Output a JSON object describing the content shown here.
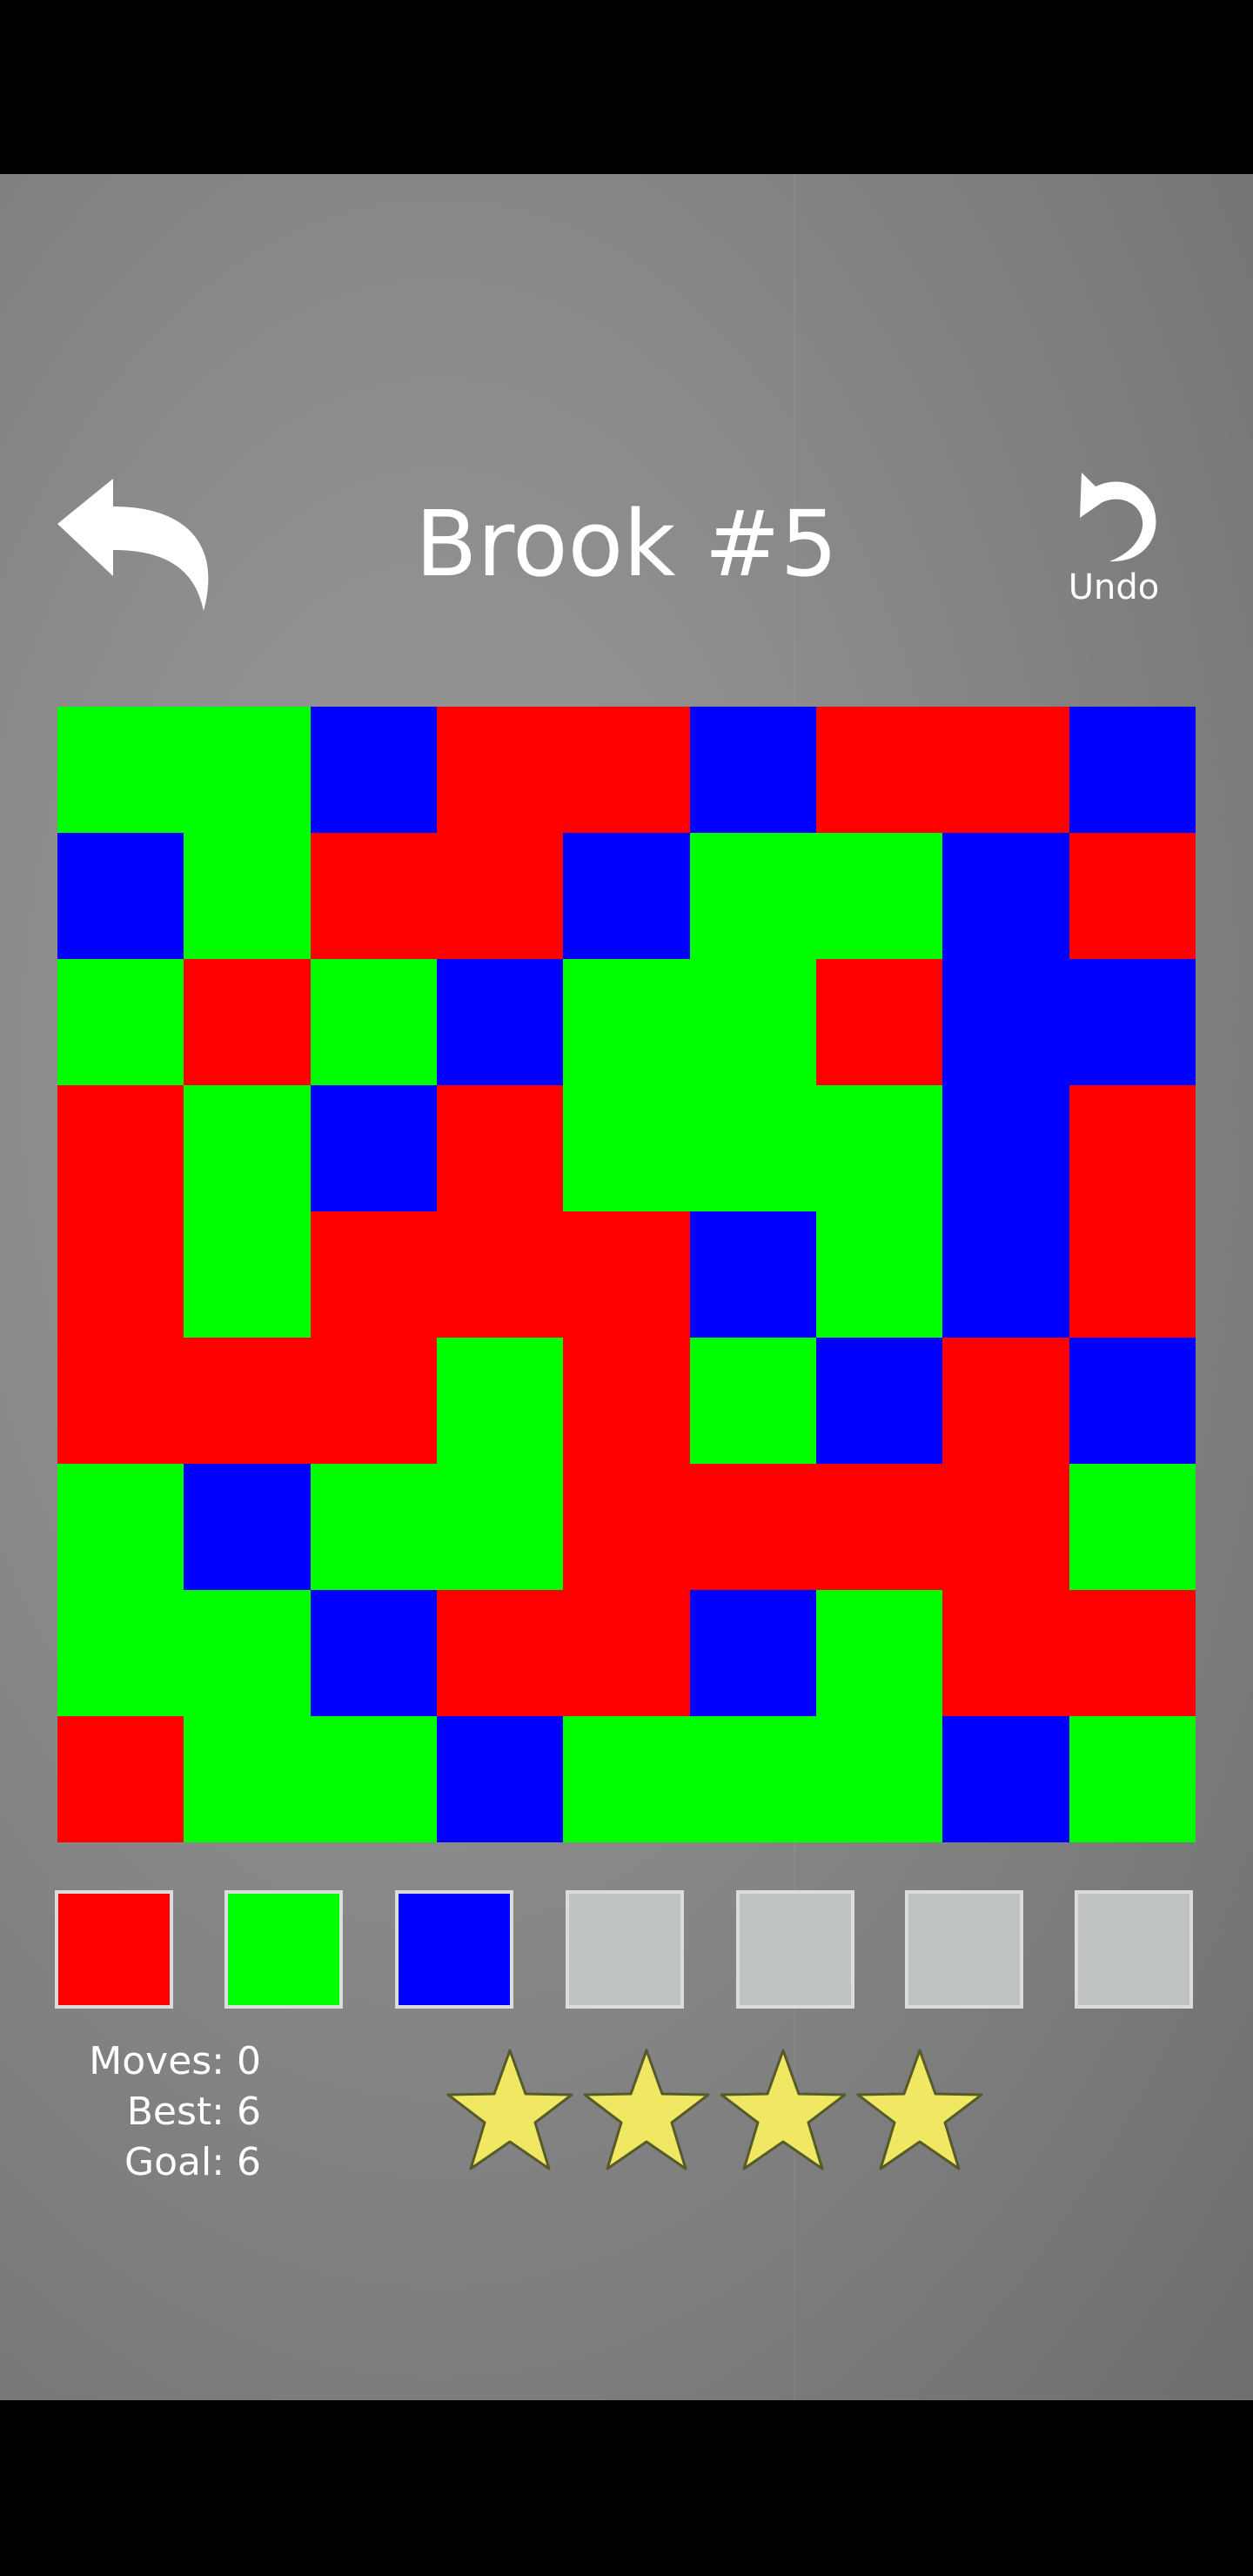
{
  "header": {
    "title": "Brook #5",
    "undo_label": "Undo"
  },
  "board": {
    "colors": {
      "R": "#ff0000",
      "G": "#00ff00",
      "B": "#0000ff"
    },
    "rows": [
      [
        "G",
        "G",
        "B",
        "R",
        "R",
        "B",
        "R",
        "R",
        "B"
      ],
      [
        "B",
        "G",
        "R",
        "R",
        "B",
        "G",
        "G",
        "B",
        "R"
      ],
      [
        "G",
        "R",
        "G",
        "B",
        "G",
        "G",
        "R",
        "B",
        "B"
      ],
      [
        "R",
        "G",
        "B",
        "R",
        "G",
        "G",
        "G",
        "B",
        "R"
      ],
      [
        "R",
        "G",
        "R",
        "R",
        "R",
        "B",
        "G",
        "B",
        "R"
      ],
      [
        "R",
        "R",
        "R",
        "G",
        "R",
        "G",
        "B",
        "R",
        "B"
      ],
      [
        "G",
        "B",
        "G",
        "G",
        "R",
        "R",
        "R",
        "R",
        "G"
      ],
      [
        "G",
        "G",
        "B",
        "R",
        "R",
        "B",
        "G",
        "R",
        "R"
      ],
      [
        "R",
        "G",
        "G",
        "B",
        "G",
        "G",
        "G",
        "B",
        "G"
      ]
    ]
  },
  "palette": [
    {
      "color": "#ff0000",
      "state": "enabled"
    },
    {
      "color": "#00ff00",
      "state": "enabled"
    },
    {
      "color": "#0000ff",
      "state": "enabled"
    },
    {
      "color": "#bfc3c3",
      "state": "disabled"
    },
    {
      "color": "#bfc3c3",
      "state": "disabled"
    },
    {
      "color": "#bfc3c3",
      "state": "disabled"
    },
    {
      "color": "#bfc3c3",
      "state": "disabled"
    }
  ],
  "stats": {
    "moves": "Moves: 0",
    "best": "Best: 6",
    "goal": "Goal: 6"
  },
  "rating": {
    "stars_filled": 4,
    "stars_total": 4,
    "star_color": "#f0e863"
  },
  "icons": {
    "back": "curved-back-arrow-icon",
    "undo": "undo-arrow-icon",
    "star": "star-icon"
  }
}
